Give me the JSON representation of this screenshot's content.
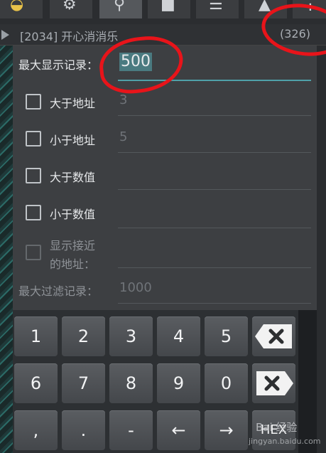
{
  "toolbar": {
    "icons": [
      "app-icon",
      "settings-gear-icon",
      "search-icon",
      "camera-icon",
      "list-icon",
      "android-icon",
      "more-icon"
    ]
  },
  "titlebar": {
    "title": "[2034] 开心消消乐",
    "count": "(326)"
  },
  "dialog": {
    "max_display_label": "最大显示记录：",
    "max_display_value": "500",
    "greater_addr_label": "大于地址",
    "greater_addr_value": "3",
    "less_addr_label": "小于地址",
    "less_addr_value": "5",
    "greater_value_label": "大于数值",
    "less_value_label": "小于数值",
    "show_near_label_1": "显示接近",
    "show_near_label_2": "的地址：",
    "max_filter_label": "最大过滤记录：",
    "max_filter_value": "1000"
  },
  "keypad": {
    "row1": [
      "1",
      "2",
      "3",
      "4",
      "5"
    ],
    "row2": [
      "6",
      "7",
      "8",
      "9",
      "0"
    ],
    "row3": [
      ",",
      ".",
      "-",
      "←",
      "→"
    ],
    "hex_label": "HEX",
    "backspace_icon": "backspace-icon",
    "clear_icon": "clear-icon"
  },
  "watermark": {
    "text": "Bai 经验",
    "sub": "jingyan.baidu.com"
  },
  "annotation_color": "#e8141a"
}
